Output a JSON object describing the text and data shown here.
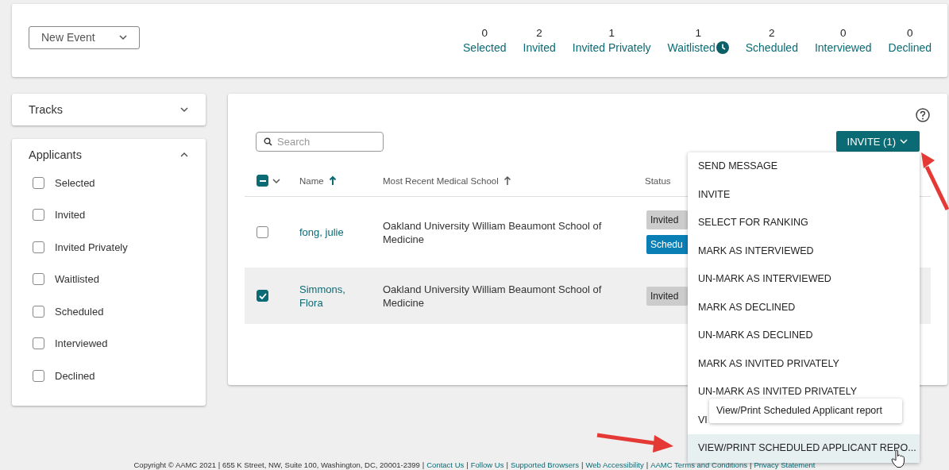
{
  "event_select": {
    "value": "New Event"
  },
  "stats": [
    {
      "count": "0",
      "label": "Selected",
      "kind": "plain"
    },
    {
      "count": "2",
      "label": "Invited",
      "kind": "plain"
    },
    {
      "count": "1",
      "label": "Invited Privately",
      "kind": "plain"
    },
    {
      "count": "1",
      "label": "Waitlisted",
      "kind": "timed"
    },
    {
      "count": "2",
      "label": "Scheduled",
      "kind": "plain"
    },
    {
      "count": "0",
      "label": "Interviewed",
      "kind": "plain"
    },
    {
      "count": "0",
      "label": "Declined",
      "kind": "plain"
    }
  ],
  "sidebar": [
    {
      "title": "Tracks",
      "expanded": false
    },
    {
      "title": "Applicants",
      "expanded": true,
      "filters": [
        {
          "label": "Selected",
          "checked": false
        },
        {
          "label": "Invited",
          "checked": false
        },
        {
          "label": "Invited Privately",
          "checked": false
        },
        {
          "label": "Waitlisted",
          "checked": false
        },
        {
          "label": "Scheduled",
          "checked": false
        },
        {
          "label": "Interviewed",
          "checked": false
        },
        {
          "label": "Declined",
          "checked": false
        }
      ]
    }
  ],
  "search": {
    "placeholder": "Search"
  },
  "invite_button": {
    "label": "INVITE (1)"
  },
  "table": {
    "select_all": {
      "indeterminate": true
    },
    "columns": [
      {
        "label": "Name",
        "sortable": true,
        "sorted": true
      },
      {
        "label": "Most Recent Medical School",
        "sortable": true,
        "sorted": false
      },
      {
        "label": "Status",
        "sortable": false,
        "sorted": false
      }
    ],
    "rows": [
      {
        "name": "fong, julie",
        "school": "Oakland University William Beaumont School of Medicine",
        "checked": false,
        "statuses": [
          {
            "text": "Invited",
            "kind": "plain"
          },
          {
            "text": "Schedu",
            "kind": "scheduled"
          }
        ]
      },
      {
        "name": "Simmons, Flora",
        "school": "Oakland University William Beaumont School of Medicine",
        "checked": true,
        "statuses": [
          {
            "text": "Invited",
            "kind": "plain"
          }
        ]
      }
    ]
  },
  "menu": {
    "items": [
      {
        "label": "SEND MESSAGE",
        "selected": false
      },
      {
        "label": "INVITE",
        "selected": false
      },
      {
        "label": "SELECT FOR RANKING",
        "selected": false
      },
      {
        "label": "MARK AS INTERVIEWED",
        "selected": false
      },
      {
        "label": "UN-MARK AS INTERVIEWED",
        "selected": false
      },
      {
        "label": "MARK AS DECLINED",
        "selected": false
      },
      {
        "label": "UN-MARK AS DECLINED",
        "selected": false
      },
      {
        "label": "MARK AS INVITED PRIVATELY",
        "selected": false
      },
      {
        "label": "UN-MARK AS INVITED PRIVATELY",
        "selected": false
      },
      {
        "label": "VI",
        "selected": false
      },
      {
        "label": "VIEW/PRINT SCHEDULED APPLICANT REPO...",
        "selected": true
      }
    ]
  },
  "tooltip": {
    "text": "View/Print Scheduled Applicant report"
  },
  "footer": [
    {
      "kind": "text",
      "text": "Copyright © AAMC 2021 | 655 K Street, NW, Suite 100, Washington, DC, 20001-2399"
    },
    {
      "kind": "sep",
      "text": "|"
    },
    {
      "kind": "link",
      "text": "Contact Us"
    },
    {
      "kind": "sep",
      "text": "|"
    },
    {
      "kind": "link",
      "text": "Follow Us"
    },
    {
      "kind": "sep",
      "text": "|"
    },
    {
      "kind": "link",
      "text": "Supported Browsers"
    },
    {
      "kind": "sep",
      "text": "|"
    },
    {
      "kind": "link",
      "text": "Web Accessibility"
    },
    {
      "kind": "sep",
      "text": "|"
    },
    {
      "kind": "link",
      "text": "AAMC Terms and Conditions"
    },
    {
      "kind": "sep",
      "text": "|"
    },
    {
      "kind": "link",
      "text": "Privacy Statement"
    }
  ]
}
